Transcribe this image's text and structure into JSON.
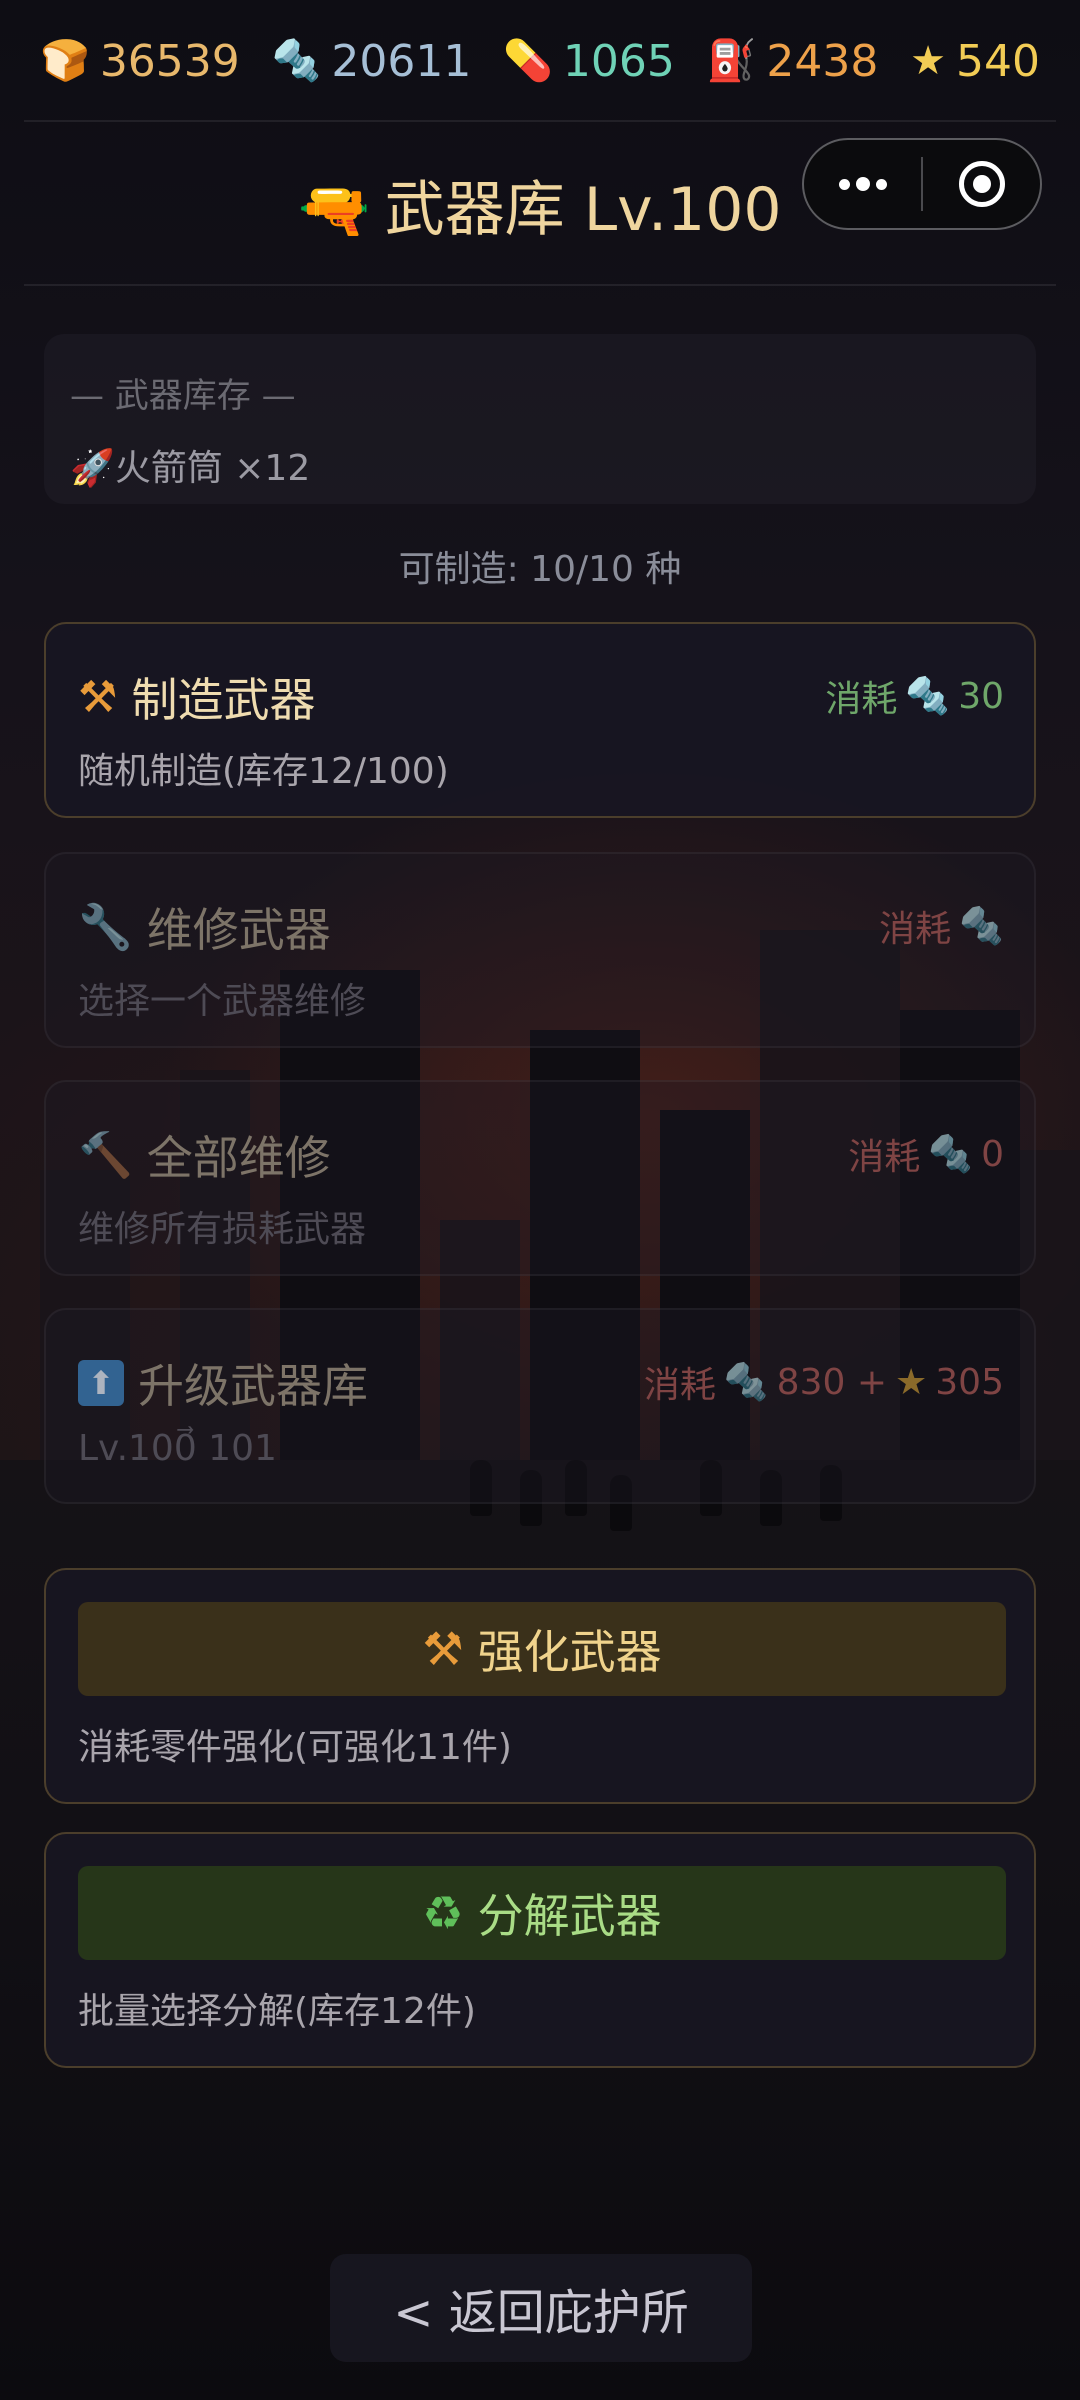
{
  "resources": [
    {
      "icon": "bread-icon",
      "glyph": "🍞",
      "value": "36539",
      "color": "#e8b86c"
    },
    {
      "icon": "bolt-icon",
      "glyph": "🔩",
      "value": "20611",
      "color": "#a6bfd6"
    },
    {
      "icon": "pill-icon",
      "glyph": "💊",
      "value": "1065",
      "color": "#6fd2b6"
    },
    {
      "icon": "fuel-pump-icon",
      "glyph": "⛽",
      "value": "2438",
      "color": "#eda14a"
    },
    {
      "icon": "star-icon",
      "glyph": "★",
      "value": "540",
      "color": "#f2cc55"
    }
  ],
  "header": {
    "icon_glyph": "🔫",
    "title": "武器库 Lv.100"
  },
  "inventory": {
    "heading": "— 武器库存 —",
    "item_glyph": "🚀",
    "item_text": "火箭筒 ×12"
  },
  "craftable_text": "可制造: 10/10 种",
  "cards": [
    {
      "name": "制造武器",
      "icon_glyph": "⚒",
      "cost_label": "消耗",
      "cost_glyph": "🔩",
      "cost_value": "30",
      "cost_color": "#6fa76a",
      "sub": "随机制造(库存12/100)"
    },
    {
      "name": "维修武器",
      "icon_glyph": "🔧",
      "cost_label": "消耗",
      "cost_glyph": "🔩",
      "cost_value": "",
      "cost_color": "#7f4444",
      "sub": "选择一个武器维修"
    },
    {
      "name": "全部维修",
      "icon_glyph": "🔨",
      "cost_label": "消耗",
      "cost_glyph": "🔩",
      "cost_value": "0",
      "cost_color": "#7f4444",
      "sub": "维修所有损耗武器"
    },
    {
      "name": "升级武器库",
      "icon_glyph": "⬆",
      "cost_label": "消耗",
      "cost_glyph": "🔩",
      "cost_value": "830 +",
      "cost_glyph2": "★",
      "cost_value2": "305",
      "cost_color": "#7f4444",
      "sub": "Lv.100⃗ 101"
    }
  ],
  "actions": [
    {
      "icon_glyph": "⚒",
      "label": "强化武器",
      "sub": "消耗零件强化(可强化11件)",
      "bg": "#3a301a",
      "color": "#f0d38c"
    },
    {
      "icon_glyph": "♻",
      "label": "分解武器",
      "sub": "批量选择分解(库存12件)",
      "bg": "#263619",
      "color": "#a9dc86"
    }
  ],
  "back_label": "< 返回庇护所"
}
